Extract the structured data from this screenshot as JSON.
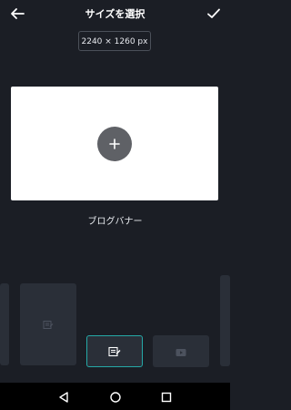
{
  "header": {
    "title": "サイズを選択"
  },
  "size": {
    "value": "2240 × 1260 px"
  },
  "canvas": {
    "caption": "ブログバナー"
  },
  "icons": {
    "back": "arrow-left-icon",
    "confirm": "check-icon",
    "add": "plus-icon",
    "document": "edit-document-icon",
    "youtube": "play-icon",
    "nav_back": "triangle-back-icon",
    "nav_home": "circle-home-icon",
    "nav_recent": "square-recent-icon"
  },
  "colors": {
    "background": "#1b1e25",
    "accent": "#25a9a7",
    "tile": "#2a2f38"
  }
}
